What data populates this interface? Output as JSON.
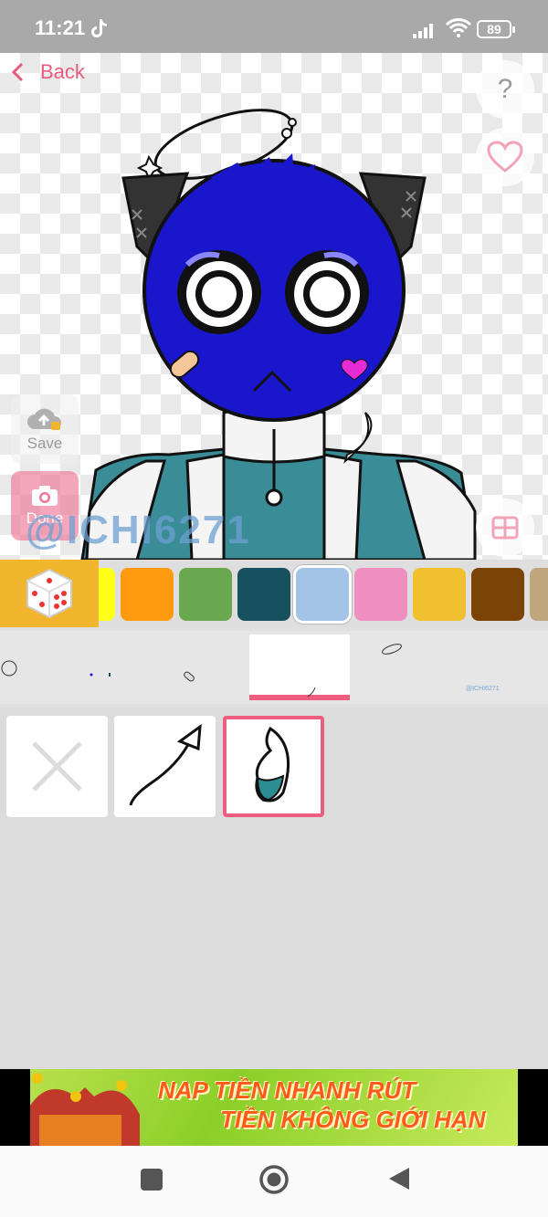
{
  "status_bar": {
    "time": "11:21",
    "battery": "89"
  },
  "header": {
    "back_label": "Back",
    "help_label": "?"
  },
  "sidebar": {
    "save_label": "Save",
    "done_label": "Done"
  },
  "canvas": {
    "watermark": "@ICHI6271"
  },
  "palette": {
    "swatches": [
      {
        "name": "yellow",
        "color": "#ffff1a"
      },
      {
        "name": "orange",
        "color": "#ff9a0e"
      },
      {
        "name": "green",
        "color": "#6aa84f"
      },
      {
        "name": "dark-teal",
        "color": "#17505e"
      },
      {
        "name": "light-blue",
        "color": "#a3c4e7",
        "selected": true
      },
      {
        "name": "pink",
        "color": "#ee8fc0"
      },
      {
        "name": "mustard",
        "color": "#f0c02f"
      },
      {
        "name": "brown",
        "color": "#7b4305"
      },
      {
        "name": "tan",
        "color": "#bfa67d"
      }
    ]
  },
  "layers": {
    "thumb_watermark": "@ICHI6271"
  },
  "ad": {
    "line1": "NAP TIỀN NHANH RÚT",
    "line2": "TIỀN KHÔNG GIỚI HẠN"
  }
}
